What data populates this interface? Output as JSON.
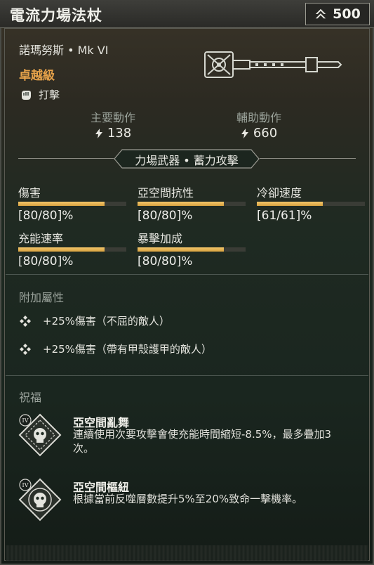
{
  "header": {
    "title": "電流力場法杖",
    "power_value": "500"
  },
  "item": {
    "name_line": "諾瑪努斯 • Mk VI",
    "rarity": "卓越級",
    "attack_type": "打擊"
  },
  "actions": {
    "primary_label": "主要動作",
    "primary_value": "138",
    "secondary_label": "輔助動作",
    "secondary_value": "660"
  },
  "weapon_category": "力場武器 • 蓄力攻擊",
  "stats": [
    {
      "name": "傷害",
      "value": "[80/80]%",
      "fill": 0.8
    },
    {
      "name": "亞空間抗性",
      "value": "[80/80]%",
      "fill": 0.8
    },
    {
      "name": "冷卻速度",
      "value": "[61/61]%",
      "fill": 0.61
    },
    {
      "name": "充能速率",
      "value": "[80/80]%",
      "fill": 0.8
    },
    {
      "name": "暴擊加成",
      "value": "[80/80]%",
      "fill": 0.8
    }
  ],
  "modifiers": {
    "title": "附加屬性",
    "items": [
      "+25%傷害（不屈的敵人）",
      "+25%傷害（帶有甲殼護甲的敵人）"
    ]
  },
  "blessings": {
    "title": "祝福",
    "items": [
      {
        "tier": "IV",
        "name": "亞空間亂舞",
        "description": "連續使用次要攻擊會使充能時間縮短-8.5%，最多疊加3次。"
      },
      {
        "tier": "IV",
        "name": "亞空間樞紐",
        "description": "根據當前反噬層數提升5%至20%致命一擊機率。"
      }
    ]
  },
  "colors": {
    "rarity": "#e6a24a",
    "bar_fill": "#e8b454",
    "section_label": "#9ba39c"
  }
}
